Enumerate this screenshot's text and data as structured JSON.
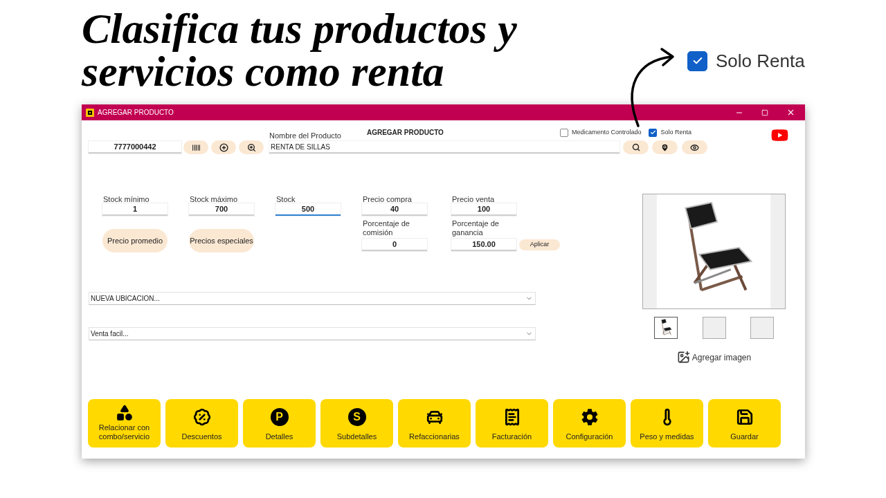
{
  "headline_lines": [
    "Clasifica tus productos y",
    "servicios como renta"
  ],
  "callout": {
    "label": "Solo Renta",
    "checked": true
  },
  "window": {
    "title": "AGREGAR PRODUCTO"
  },
  "form": {
    "heading": "AGREGAR PRODUCTO",
    "code": "7777000442",
    "name_label": "Nombre del Producto",
    "name_value": "RENTA DE SILLAS",
    "checkboxes": [
      {
        "label": "Medicamento Controlado",
        "checked": false
      },
      {
        "label": "Solo Renta",
        "checked": true
      }
    ],
    "stock_fields": [
      {
        "label": "Stock mínimo",
        "value": "1",
        "focused": false
      },
      {
        "label": "Stock máximo",
        "value": "700",
        "focused": false
      },
      {
        "label": "Stock",
        "value": "500",
        "focused": true
      }
    ],
    "stock_buttons": [
      "Precio promedio",
      "Precios especiales"
    ],
    "price_fields": [
      {
        "label": "Precio compra",
        "value": "40"
      },
      {
        "label": "Precio venta",
        "value": "100"
      }
    ],
    "percent_fields": [
      {
        "label": "Porcentaje de comisión",
        "value": "0"
      },
      {
        "label": "Porcentaje de ganancia",
        "value": "150.00"
      }
    ],
    "apply_button": "Aplicar",
    "dropdowns": [
      "NUEVA UBICACION...",
      "Venta facil..."
    ]
  },
  "images": {
    "thumbnails": [
      {
        "kind": "picture",
        "selected": true
      },
      {
        "kind": "empty",
        "selected": false
      },
      {
        "kind": "empty",
        "selected": false
      }
    ],
    "add_label": "Agregar imagen"
  },
  "actions": [
    {
      "kind": "relate",
      "label": "Relacionar con combo/servicio"
    },
    {
      "kind": "discount",
      "label": "Descuentos"
    },
    {
      "kind": "letter",
      "badge": "P",
      "label": "Detalles"
    },
    {
      "kind": "letter",
      "badge": "S",
      "label": "Subdetalles"
    },
    {
      "kind": "car",
      "label": "Refaccionarias"
    },
    {
      "kind": "invoice",
      "label": "Facturación"
    },
    {
      "kind": "gear",
      "label": "Configuración"
    },
    {
      "kind": "measure",
      "label": "Peso y medidas"
    },
    {
      "kind": "save",
      "label": "Guardar"
    }
  ]
}
